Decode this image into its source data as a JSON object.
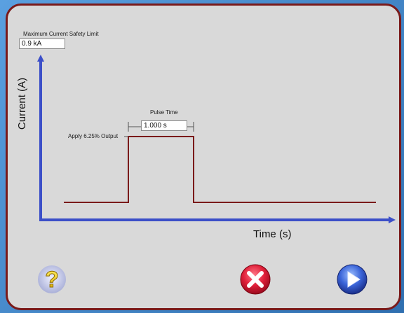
{
  "limit": {
    "label": "Maximum Current Safety Limit",
    "value": "0.9 kA"
  },
  "axes": {
    "y_label": "Current (A)",
    "x_label": "Time (s)"
  },
  "pulse": {
    "time_label": "Pulse Time",
    "time_value": "1.000 s",
    "output_label": "Apply 6.25% Output"
  },
  "buttons": {
    "help_icon": "question-mark-icon",
    "cancel_icon": "x-icon",
    "next_icon": "play-arrow-icon"
  },
  "colors": {
    "frame": "#7a1a1a",
    "axis": "#3c4fc8",
    "pulse": "#7a1a1a",
    "panel": "#d9d9d9"
  }
}
